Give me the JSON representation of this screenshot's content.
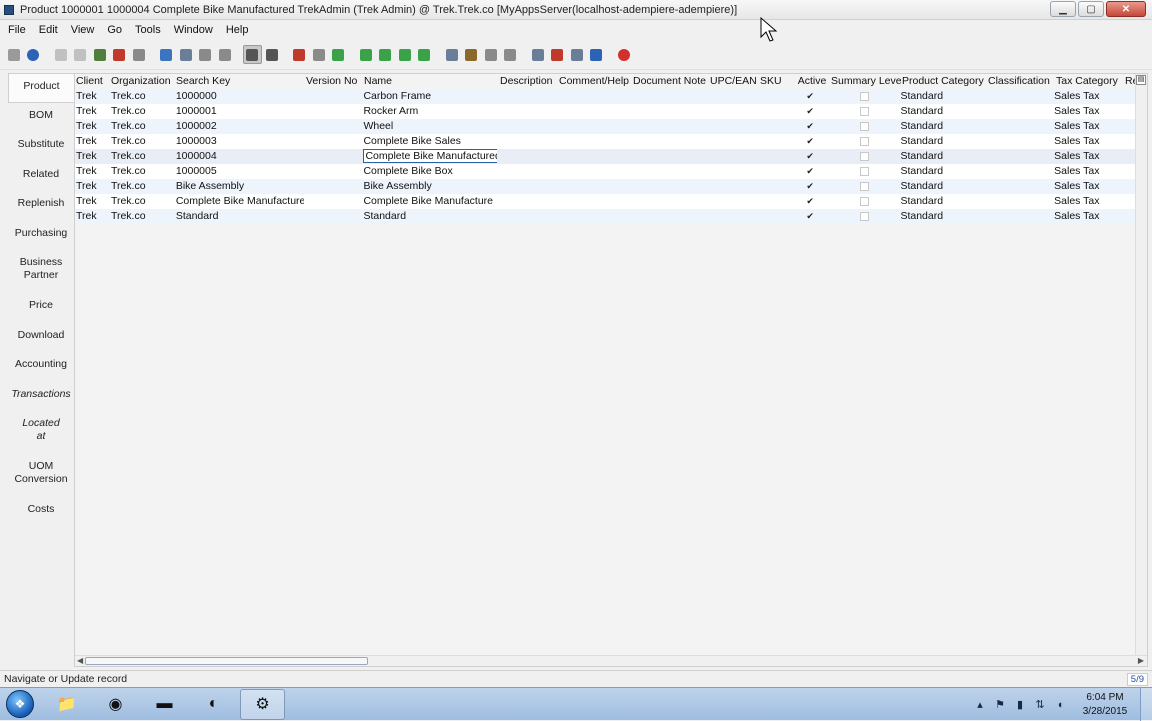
{
  "window": {
    "title": "Product  1000001  1000004  Complete Bike Manufactured  TrekAdmin (Trek Admin) @ Trek.Trek.co [MyAppsServer(localhost-adempiere-adempiere)]",
    "minimize_icon": "minimize-icon",
    "maximize_icon": "maximize-icon",
    "close_icon": "close-icon"
  },
  "menubar": {
    "items": [
      "File",
      "Edit",
      "View",
      "Go",
      "Tools",
      "Window",
      "Help"
    ]
  },
  "toolbar": {
    "buttons": [
      {
        "icon": "undo-icon",
        "color": "#9a9a9a"
      },
      {
        "icon": "help-icon",
        "color": "#2c63b6"
      },
      {
        "icon": "new-record-icon",
        "color": "#c0c0c0"
      },
      {
        "icon": "copy-record-icon",
        "color": "#c0c0c0"
      },
      {
        "icon": "archive-icon",
        "color": "#4f7f3a"
      },
      {
        "icon": "delete-icon",
        "color": "#c0392b"
      },
      {
        "icon": "save-icon",
        "color": "#8a8a8a"
      },
      {
        "icon": "refresh-icon",
        "color": "#3d74c2"
      },
      {
        "icon": "find-icon",
        "color": "#6b7e99"
      },
      {
        "icon": "attachment-icon",
        "color": "#8a8a8a"
      },
      {
        "icon": "multi-window-icon",
        "color": "#8a8a8a"
      },
      {
        "icon": "grid-toggle-icon",
        "color": "#555555"
      },
      {
        "icon": "history-icon",
        "color": "#555555"
      },
      {
        "icon": "home-icon",
        "color": "#c0392b"
      },
      {
        "icon": "back-icon",
        "color": "#8a8a8a"
      },
      {
        "icon": "forward-icon",
        "color": "#3aa34a"
      },
      {
        "icon": "first-record-icon",
        "color": "#3aa34a"
      },
      {
        "icon": "previous-record-icon",
        "color": "#3aa34a"
      },
      {
        "icon": "next-record-icon",
        "color": "#3aa34a"
      },
      {
        "icon": "last-record-icon",
        "color": "#3aa34a"
      },
      {
        "icon": "report-icon",
        "color": "#6b7e99"
      },
      {
        "icon": "archived-docs-icon",
        "color": "#8a6a2a"
      },
      {
        "icon": "print-preview-icon",
        "color": "#8a8a8a"
      },
      {
        "icon": "print-icon",
        "color": "#8a8a8a"
      },
      {
        "icon": "zoom-across-icon",
        "color": "#6b7e99"
      },
      {
        "icon": "workflow-icon",
        "color": "#c0392b"
      },
      {
        "icon": "process-icon",
        "color": "#6b7e99"
      },
      {
        "icon": "product-info-icon",
        "color": "#2c63b6"
      },
      {
        "icon": "exit-icon",
        "color": "#d32f2f"
      }
    ]
  },
  "tabs": [
    {
      "label": "Product",
      "active": true
    },
    {
      "label": "BOM"
    },
    {
      "label": "Substitute"
    },
    {
      "label": "Related"
    },
    {
      "label": "Replenish"
    },
    {
      "label": "Purchasing"
    },
    {
      "label": "Business Partner"
    },
    {
      "label": "Price"
    },
    {
      "label": "Download"
    },
    {
      "label": "Accounting"
    },
    {
      "label": "Transactions",
      "italic": true
    },
    {
      "label": "Located at",
      "italic": true
    },
    {
      "label": "UOM Conversion"
    },
    {
      "label": "Costs"
    }
  ],
  "grid": {
    "columns": [
      "Client",
      "Organization",
      "Search Key",
      "Version No",
      "Name",
      "Description",
      "Comment/Help",
      "Document Note",
      "UPC/EAN",
      "SKU",
      "Active",
      "Summary Level",
      "Product Category",
      "Classification",
      "Tax Category",
      "Re"
    ],
    "rows": [
      {
        "client": "Trek",
        "org": "Trek.co",
        "key": "1000000",
        "name": "Carbon Frame",
        "active": true,
        "summary": false,
        "category": "Standard",
        "tax": "Sales Tax"
      },
      {
        "client": "Trek",
        "org": "Trek.co",
        "key": "1000001",
        "name": "Rocker Arm",
        "active": true,
        "summary": false,
        "category": "Standard",
        "tax": "Sales Tax"
      },
      {
        "client": "Trek",
        "org": "Trek.co",
        "key": "1000002",
        "name": "Wheel",
        "active": true,
        "summary": false,
        "category": "Standard",
        "tax": "Sales Tax"
      },
      {
        "client": "Trek",
        "org": "Trek.co",
        "key": "1000003",
        "name": "Complete Bike Sales",
        "active": true,
        "summary": false,
        "category": "Standard",
        "tax": "Sales Tax"
      },
      {
        "client": "Trek",
        "org": "Trek.co",
        "key": "1000004",
        "name": "Complete Bike Manufactured",
        "active": true,
        "summary": false,
        "category": "Standard",
        "tax": "Sales Tax",
        "current": true
      },
      {
        "client": "Trek",
        "org": "Trek.co",
        "key": "1000005",
        "name": "Complete Bike Box",
        "active": true,
        "summary": false,
        "category": "Standard",
        "tax": "Sales Tax"
      },
      {
        "client": "Trek",
        "org": "Trek.co",
        "key": "Bike Assembly",
        "name": "Bike Assembly",
        "active": true,
        "summary": false,
        "category": "Standard",
        "tax": "Sales Tax"
      },
      {
        "client": "Trek",
        "org": "Trek.co",
        "key": "Complete Bike Manufacture",
        "name": "Complete Bike Manufacture",
        "active": true,
        "summary": false,
        "category": "Standard",
        "tax": "Sales Tax"
      },
      {
        "client": "Trek",
        "org": "Trek.co",
        "key": "Standard",
        "name": "Standard",
        "active": true,
        "summary": false,
        "category": "Standard",
        "tax": "Sales Tax"
      }
    ]
  },
  "statusbar": {
    "message": "Navigate or Update record",
    "record_count": "5/9"
  },
  "taskbar": {
    "apps": [
      {
        "icon": "file-explorer-icon",
        "glyph": "📁"
      },
      {
        "icon": "chrome-icon",
        "glyph": "◉"
      },
      {
        "icon": "terminal-icon",
        "glyph": "▬"
      },
      {
        "icon": "java-app-icon",
        "glyph": "◐"
      },
      {
        "icon": "adempiere-icon",
        "glyph": "⚙",
        "active": true
      }
    ],
    "clock_time": "6:04 PM",
    "clock_date": "3/28/2015"
  },
  "colors": {
    "exit_button": "#d32f2f",
    "focus_border": "#2a5fb0",
    "taskbar": "#aec8e6"
  }
}
